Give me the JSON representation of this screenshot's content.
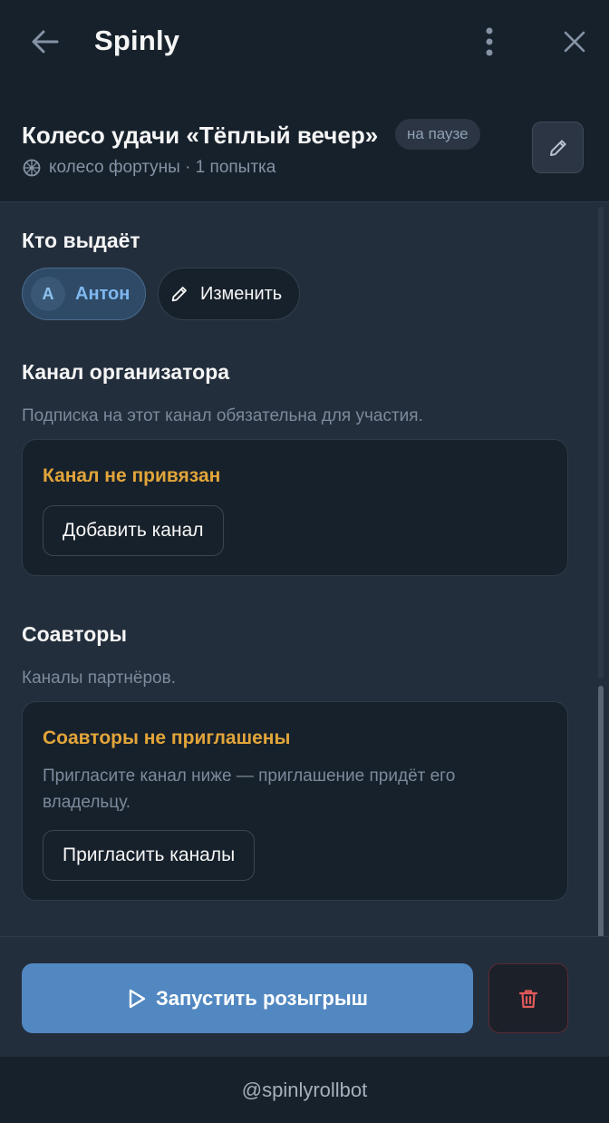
{
  "app": {
    "title": "Spinly"
  },
  "header": {
    "title": "Колесо удачи «Тёплый вечер»",
    "status": "на паузе",
    "subtitle": "колесо фортуны · 1 попытка"
  },
  "issuer": {
    "title": "Кто выдаёт",
    "user_initial": "A",
    "user_name": "Антон",
    "change_label": "Изменить"
  },
  "organizer_channel": {
    "title": "Канал организатора",
    "description": "Подписка на этот канал обязательна для участия.",
    "card_title": "Канал не привязан",
    "button_label": "Добавить канал"
  },
  "coauthors": {
    "title": "Соавторы",
    "description": "Каналы партнёров.",
    "card_title": "Соавторы не приглашены",
    "card_text": "Пригласите канал ниже — приглашение придёт его владельцу.",
    "button_label": "Пригласить каналы"
  },
  "actions": {
    "start_label": "Запустить розыгрыш"
  },
  "footer": {
    "bot_handle": "@spinlyrollbot"
  },
  "colors": {
    "accent": "#5288c1",
    "warning": "#e2a53a",
    "danger": "#e05a5a",
    "background": "#232e3c",
    "surface": "#17212b"
  },
  "icons": {
    "back": "arrow-left-icon",
    "more": "kebab-menu-icon",
    "close": "close-icon",
    "edit": "pencil-icon",
    "wheel": "wheel-icon",
    "play": "play-icon",
    "delete": "trash-icon"
  }
}
